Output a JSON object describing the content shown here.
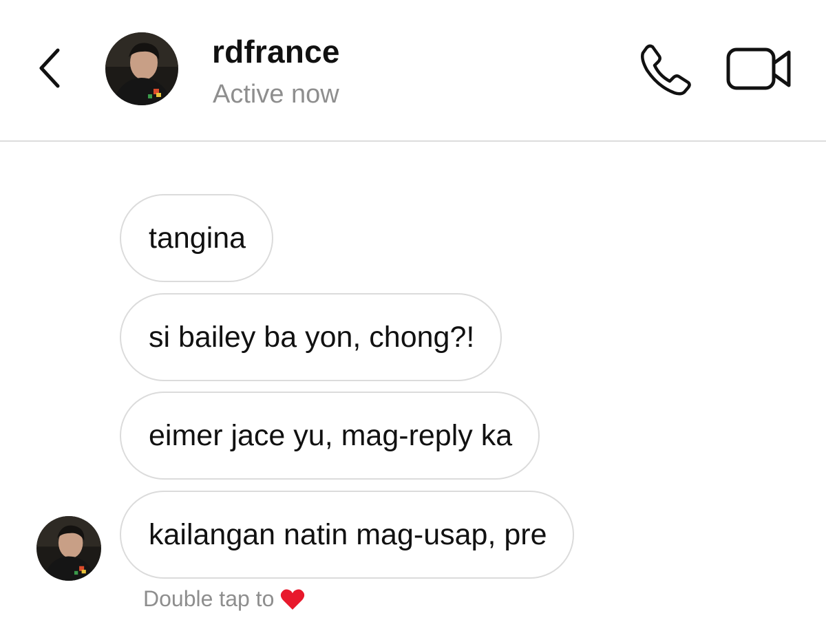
{
  "header": {
    "username": "rdfrance",
    "status": "Active now",
    "back_icon": "chevron-left-icon",
    "call_icon": "phone-icon",
    "video_icon": "video-camera-icon"
  },
  "messages": [
    {
      "text": "tangina"
    },
    {
      "text": "si bailey ba yon, chong?!"
    },
    {
      "text": "eimer jace yu, mag-reply ka"
    },
    {
      "text": "kailangan natin mag-usap, pre"
    }
  ],
  "hint": {
    "text": "Double tap to",
    "icon": "heart-icon",
    "heart_color": "#e8192c"
  },
  "colors": {
    "bubble_border": "#dbdbdb",
    "secondary_text": "#8e8e8e"
  }
}
